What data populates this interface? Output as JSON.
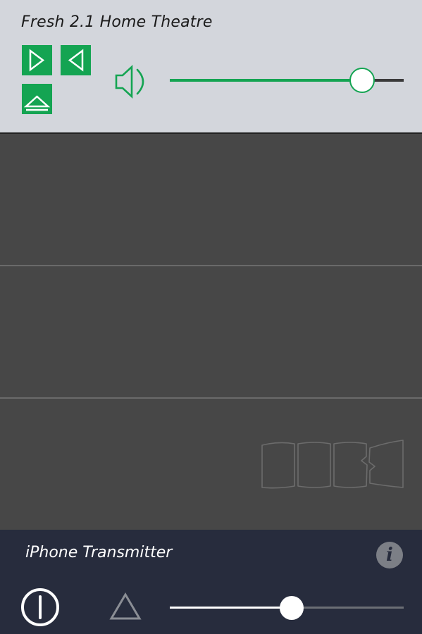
{
  "device": {
    "title": "Fresh 2.1 Home Theatre",
    "volume_fraction": 0.82,
    "route_buttons": [
      {
        "icon": "play-right-icon"
      },
      {
        "icon": "play-left-icon"
      },
      {
        "icon": "eject-up-icon"
      }
    ],
    "speaker_icon": "speaker-volume-icon"
  },
  "transmitter": {
    "title": "iPhone Transmitter",
    "info_label": "i",
    "power_icon": "power-icon",
    "eject_icon": "eject-triangle-icon",
    "volume_fraction": 0.52
  },
  "colors": {
    "accent_green": "#14a452",
    "device_panel_bg": "#d3d6dc",
    "middle_bg": "#474747",
    "transmitter_bg": "#272c3d"
  }
}
